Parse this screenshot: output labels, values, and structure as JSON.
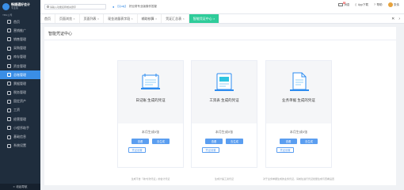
{
  "sidebar": {
    "logo_name": "畅捷通好会计",
    "logo_sub": "专业版",
    "company": "YBG公司",
    "items": [
      {
        "label": "首页",
        "icon": "home-icon"
      },
      {
        "label": "营销推广",
        "icon": "megaphone-icon"
      },
      {
        "label": "销售管理",
        "icon": "sales-icon"
      },
      {
        "label": "采购管理",
        "icon": "cart-icon"
      },
      {
        "label": "库存管理",
        "icon": "box-icon"
      },
      {
        "label": "资金管理",
        "icon": "wallet-icon"
      },
      {
        "label": "总账管理",
        "icon": "ledger-icon"
      },
      {
        "label": "票据管理",
        "icon": "bill-icon"
      },
      {
        "label": "税务管理",
        "icon": "tax-icon"
      },
      {
        "label": "固定资产",
        "icon": "asset-icon"
      },
      {
        "label": "工资",
        "icon": "salary-icon"
      },
      {
        "label": "经营管理",
        "icon": "chart-icon"
      },
      {
        "label": "小程序助手",
        "icon": "miniapp-icon"
      },
      {
        "label": "基础信息",
        "icon": "info-icon"
      },
      {
        "label": "系统设置",
        "icon": "gear-icon"
      }
    ],
    "active_index": 6,
    "collapse_label": "收起导航"
  },
  "topbar": {
    "search_placeholder": "请输入功能名称或关键字",
    "notice_tag": "【Quaj】",
    "notice_text": "好业财专业版操作答疑",
    "messages_label": "消息",
    "message_count": "8",
    "app_label": "App下载",
    "help_label": "帮助",
    "user_label": "张伟"
  },
  "tabs": [
    {
      "label": "首页",
      "closable": false
    },
    {
      "label": "页面浏览",
      "closable": true
    },
    {
      "label": "页面列表",
      "closable": true
    },
    {
      "label": "现金流量表字段",
      "closable": true
    },
    {
      "label": "辅助核算",
      "closable": true
    },
    {
      "label": "凭证汇总表",
      "closable": true
    },
    {
      "label": "智能凭证中心",
      "closable": true
    }
  ],
  "active_tab": 6,
  "page": {
    "title": "智能凭证中心",
    "cards": [
      {
        "title": "日记账 生成的凭证",
        "count": "本月生成0张",
        "btn1": "查看",
        "btn2": "去生成",
        "btn3": "凭证设置",
        "note": "生成不含「收/付款凭证」的会计凭证",
        "icon": "journal-book-icon"
      },
      {
        "title": "工资表 生成的凭证",
        "count": "本月生成0张",
        "btn1": "查看",
        "btn2": "去生成",
        "btn3": "凭证设置",
        "note": "生成计提工资凭证",
        "icon": "payroll-icon"
      },
      {
        "title": "业务单据 生成的凭证",
        "count": "本月生成0张",
        "btn1": "查看",
        "btn2": "去生成",
        "btn3": "凭证设置",
        "note": "对于业务单据生成的业务凭证，请前往进行凭证批量生成与查看设置",
        "icon": "document-icon"
      }
    ]
  },
  "colors": {
    "sidebar_bg": "#1f2d3d",
    "accent": "#3a8ee6",
    "active_tab": "#2ecc9a",
    "button": "#5b9ef0"
  }
}
